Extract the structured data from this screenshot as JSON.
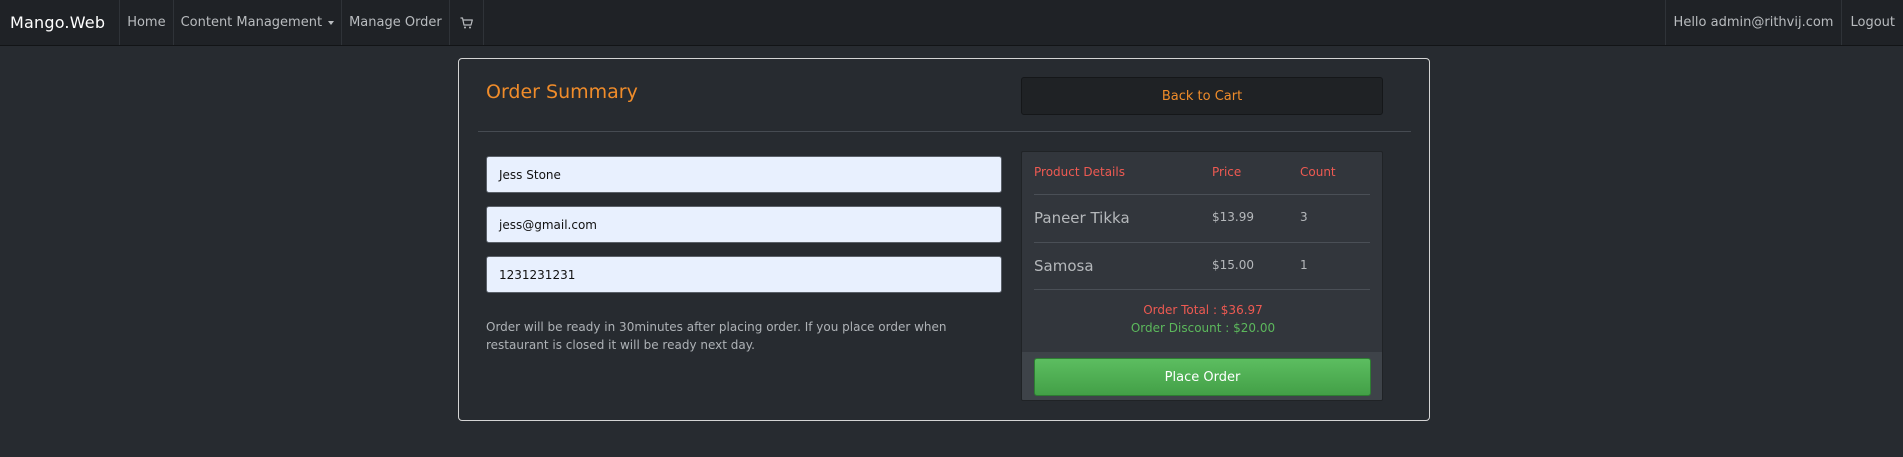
{
  "navbar": {
    "brand": "Mango.Web",
    "items": [
      {
        "label": "Home"
      },
      {
        "label": "Content Management"
      },
      {
        "label": "Manage Order"
      }
    ],
    "cart_icon": "cart-icon",
    "greeting": "Hello admin@rithvij.com",
    "logout": "Logout"
  },
  "page": {
    "title": "Order Summary",
    "back_button": "Back to Cart"
  },
  "form": {
    "name": "Jess Stone",
    "email": "jess@gmail.com",
    "phone": "1231231231",
    "note": "Order will be ready in 30minutes after placing order. If you place order when restaurant is closed it will be ready next day."
  },
  "summary": {
    "headers": {
      "product": "Product Details",
      "price": "Price",
      "count": "Count"
    },
    "rows": [
      {
        "product": "Paneer Tikka",
        "price": "$13.99",
        "count": "3"
      },
      {
        "product": "Samosa",
        "price": "$15.00",
        "count": "1"
      }
    ],
    "order_total": "Order Total : $36.97",
    "order_discount": "Order Discount : $20.00",
    "place_order": "Place Order"
  },
  "colors": {
    "accent": "#f08c2a",
    "header_red": "#ee5a52",
    "discount_green": "#5cb85c",
    "button_green": "#4cae4f"
  }
}
